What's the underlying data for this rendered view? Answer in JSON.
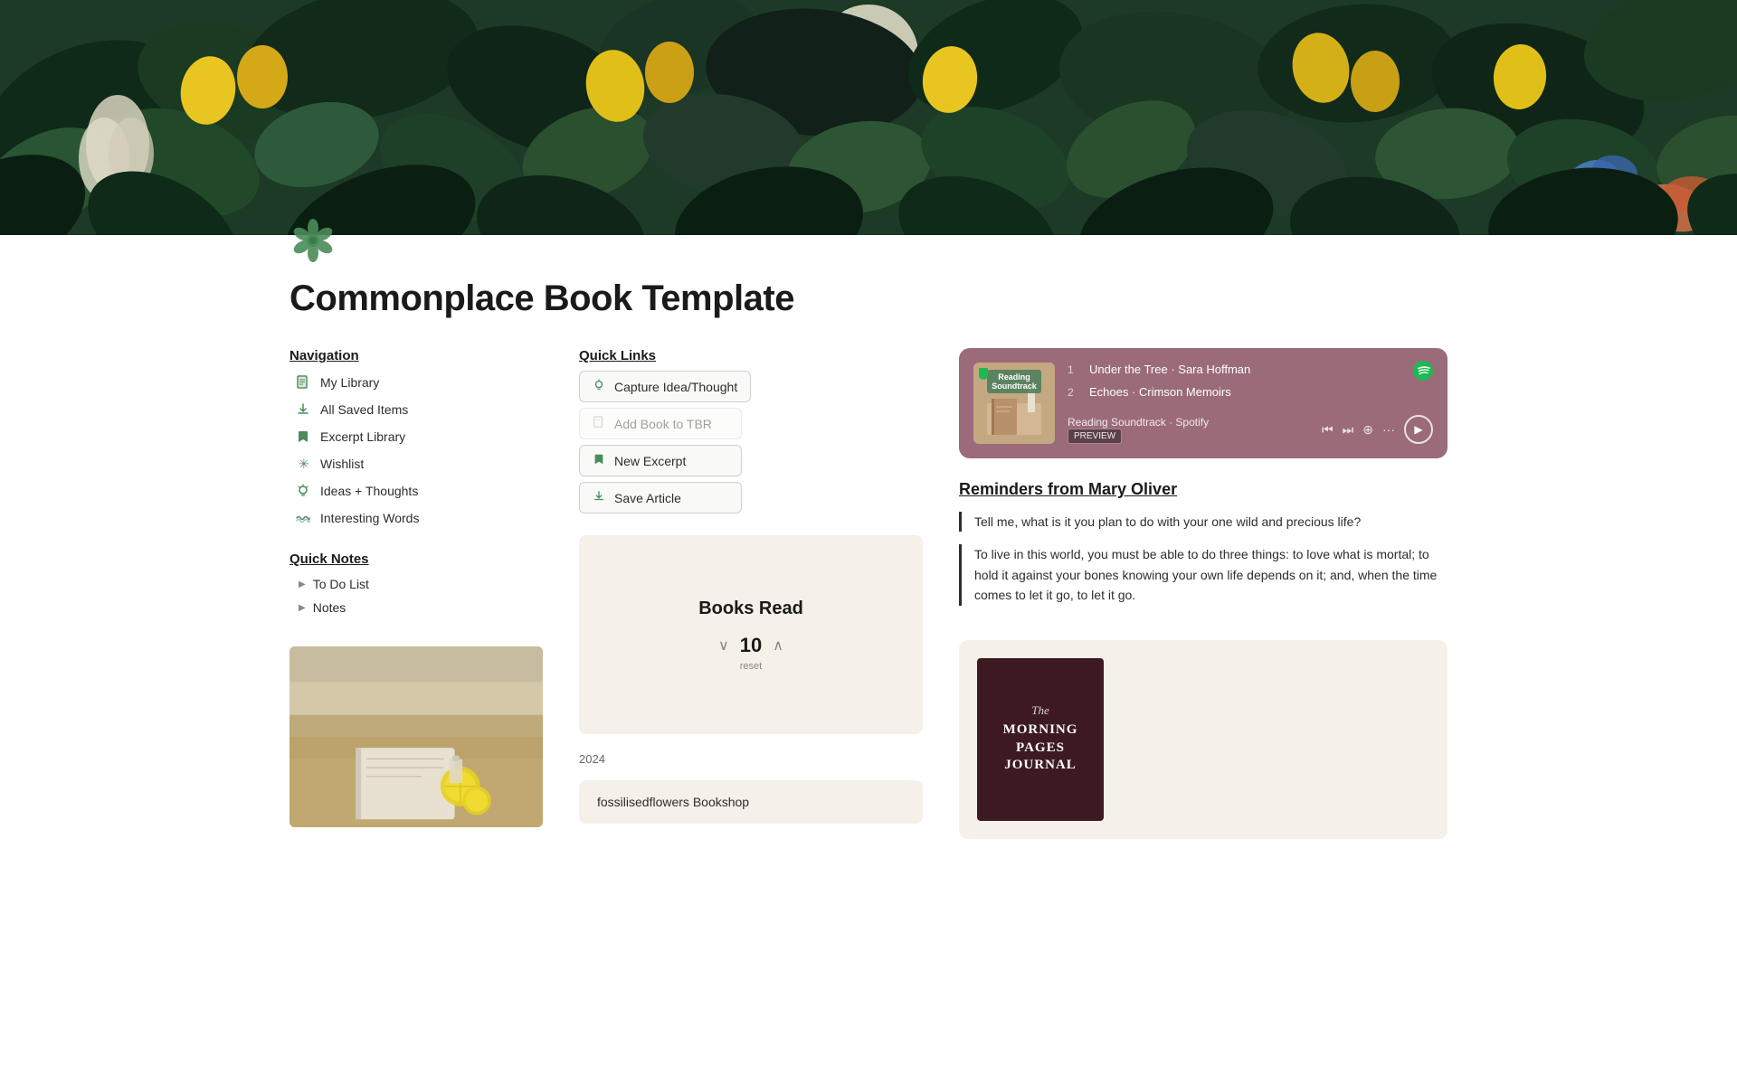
{
  "header": {
    "banner_alt": "Tropical jungle painting banner",
    "icon_alt": "React flower icon"
  },
  "page": {
    "title": "Commonplace Book Template"
  },
  "sidebar": {
    "navigation_heading": "Navigation",
    "nav_items": [
      {
        "id": "my-library",
        "label": "My Library",
        "icon": "book"
      },
      {
        "id": "all-saved",
        "label": "All Saved Items",
        "icon": "download"
      },
      {
        "id": "excerpt-library",
        "label": "Excerpt Library",
        "icon": "bookmark"
      },
      {
        "id": "wishlist",
        "label": "Wishlist",
        "icon": "asterisk"
      },
      {
        "id": "ideas-thoughts",
        "label": "Ideas + Thoughts",
        "icon": "bulb"
      },
      {
        "id": "interesting-words",
        "label": "Interesting Words",
        "icon": "wave"
      }
    ],
    "quick_notes_heading": "Quick Notes",
    "quick_notes_items": [
      {
        "id": "to-do",
        "label": "To Do List"
      },
      {
        "id": "notes",
        "label": "Notes"
      }
    ]
  },
  "quick_links": {
    "heading": "Quick Links",
    "buttons": [
      {
        "id": "capture-idea",
        "label": "Capture Idea/Thought",
        "icon": "bulb",
        "disabled": false
      },
      {
        "id": "add-book-tbr",
        "label": "Add Book to TBR",
        "icon": "book-small",
        "disabled": true
      },
      {
        "id": "new-excerpt",
        "label": "New Excerpt",
        "icon": "bookmark-btn",
        "disabled": false
      },
      {
        "id": "save-article",
        "label": "Save Article",
        "icon": "download-btn",
        "disabled": false
      }
    ]
  },
  "books_read": {
    "title": "Books Read",
    "count": 10,
    "reset_label": "reset",
    "year": "2024"
  },
  "bookshop": {
    "name": "fossilisedflowers Bookshop"
  },
  "spotify": {
    "label_line1": "Reading",
    "label_line2": "Soundtrack",
    "tracks": [
      {
        "num": "1",
        "title": "Under the Tree · Sara Hoffman"
      },
      {
        "num": "2",
        "title": "Echoes · Crimson Memoirs"
      }
    ],
    "playlist": "Reading Soundtrack · Spotify",
    "preview_label": "PREVIEW"
  },
  "reminders": {
    "heading": "Reminders from Mary Oliver",
    "quotes": [
      "Tell me, what is it you plan to do with your one wild and precious life?",
      "To live in this world, you must be able to do three things: to love what is mortal; to hold it against your bones knowing your own life depends on it; and, when the time comes to let it go, to let it go."
    ]
  },
  "book_showcase": {
    "the_label": "The",
    "title_line1": "MORNING PAGES",
    "title_line2": "JOURNAL"
  }
}
